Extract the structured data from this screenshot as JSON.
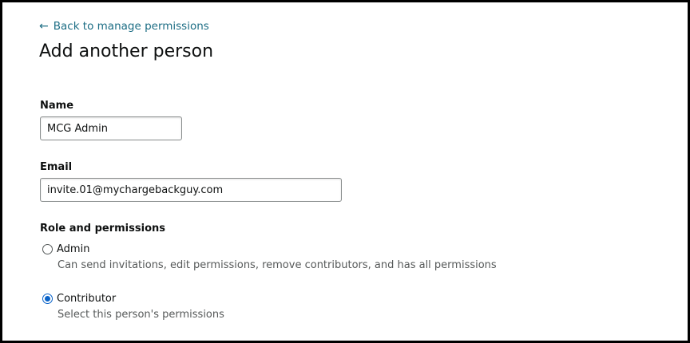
{
  "back_link": {
    "arrow": "←",
    "label": "Back to manage permissions"
  },
  "page_title": "Add another person",
  "form": {
    "name": {
      "label": "Name",
      "value": "MCG Admin"
    },
    "email": {
      "label": "Email",
      "value": "invite.01@mychargebackguy.com"
    }
  },
  "role": {
    "section_label": "Role and permissions",
    "selected": "Contributor",
    "options": [
      {
        "label": "Admin",
        "description": "Can send invitations, edit permissions, remove contributors, and has all permissions",
        "checked": false
      },
      {
        "label": "Contributor",
        "description": "Select this person's permissions",
        "checked": true
      }
    ]
  },
  "colors": {
    "link": "#1c6d84",
    "radio_selected": "#0a63c9",
    "text": "#0f1111",
    "muted_text": "#565959",
    "frame_border": "#000000"
  }
}
